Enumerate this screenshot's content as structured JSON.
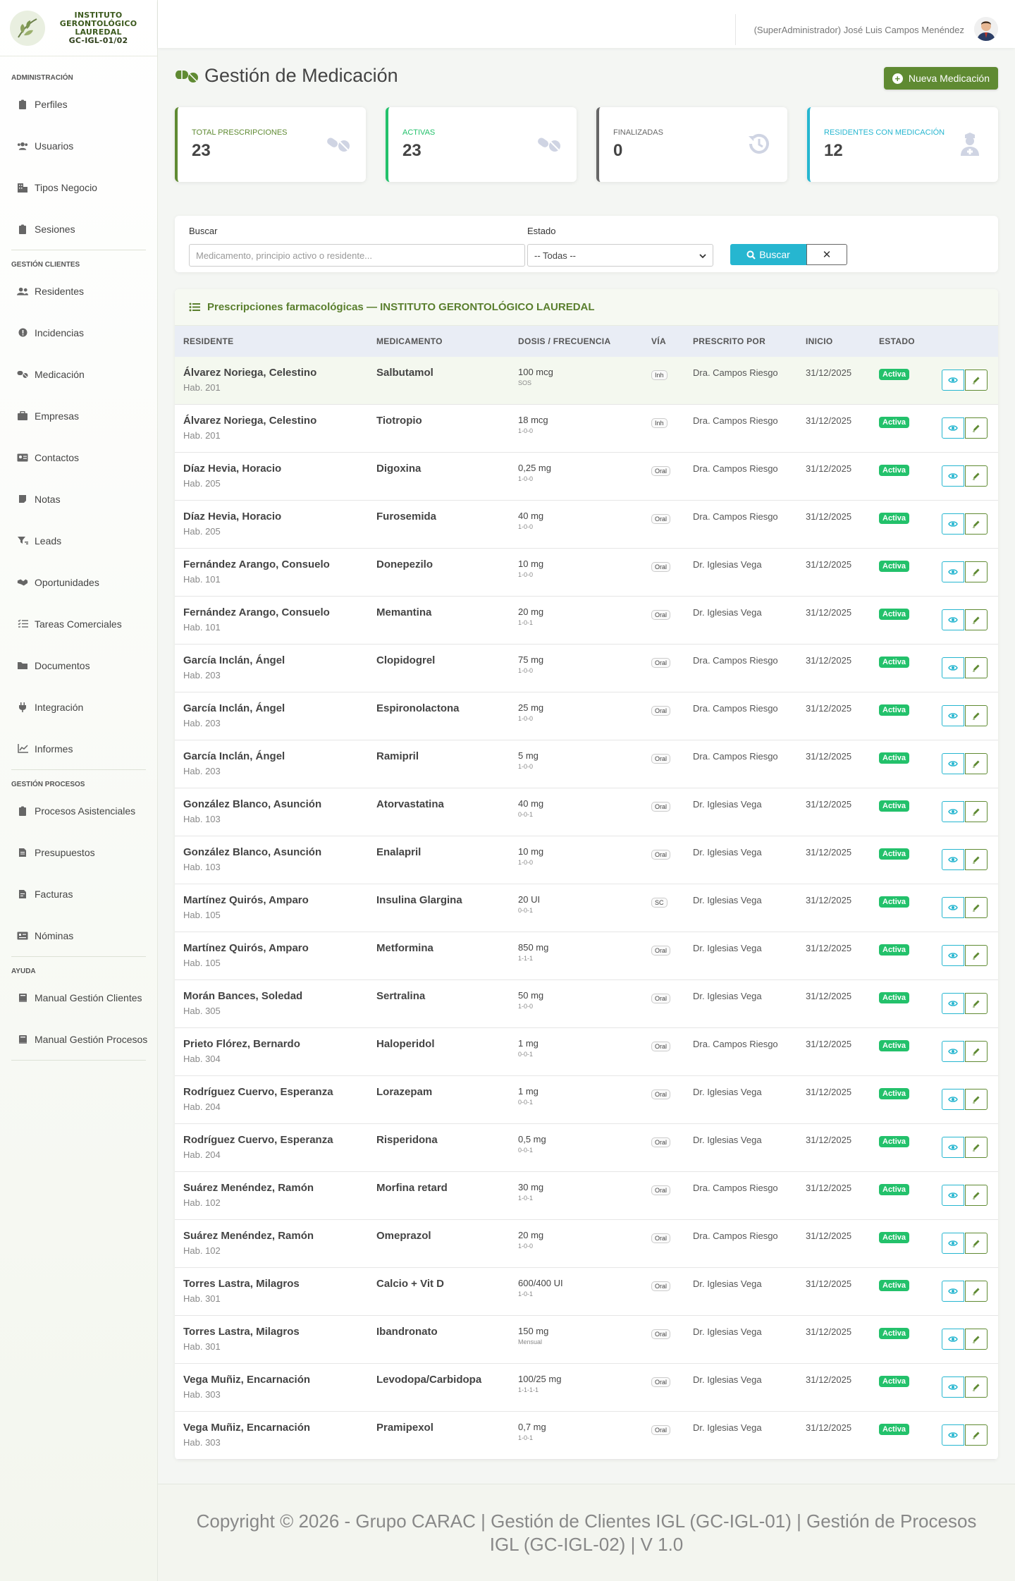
{
  "brand": {
    "line1": "INSTITUTO",
    "line2": "GERONTOLÓGICO",
    "line3": "LAUREDAL",
    "code": "GC-IGL-01/02"
  },
  "sidebar": {
    "sections": [
      {
        "title": "ADMINISTRACIÓN",
        "items": [
          {
            "label": "Perfiles",
            "icon": "clipboard-icon"
          },
          {
            "label": "Usuarios",
            "icon": "users-icon"
          },
          {
            "label": "Tipos Negocio",
            "icon": "building-icon"
          },
          {
            "label": "Sesiones",
            "icon": "clipboard-icon"
          }
        ]
      },
      {
        "title": "GESTIÓN CLIENTES",
        "items": [
          {
            "label": "Residentes",
            "icon": "user-group-icon"
          },
          {
            "label": "Incidencias",
            "icon": "alert-icon"
          },
          {
            "label": "Medicación",
            "icon": "pills-icon"
          },
          {
            "label": "Empresas",
            "icon": "briefcase-icon"
          },
          {
            "label": "Contactos",
            "icon": "contact-card-icon"
          },
          {
            "label": "Notas",
            "icon": "note-icon"
          },
          {
            "label": "Leads",
            "icon": "funnel-icon"
          },
          {
            "label": "Oportunidades",
            "icon": "handshake-icon"
          },
          {
            "label": "Tareas Comerciales",
            "icon": "tasks-icon"
          },
          {
            "label": "Documentos",
            "icon": "folder-icon"
          },
          {
            "label": "Integración",
            "icon": "plug-icon"
          },
          {
            "label": "Informes",
            "icon": "chart-line-icon"
          }
        ]
      },
      {
        "title": "GESTIÓN PROCESOS",
        "items": [
          {
            "label": "Procesos Asistenciales",
            "icon": "clipboard-icon"
          },
          {
            "label": "Presupuestos",
            "icon": "document-icon"
          },
          {
            "label": "Facturas",
            "icon": "invoice-icon"
          },
          {
            "label": "Nóminas",
            "icon": "payroll-icon"
          }
        ]
      },
      {
        "title": "AYUDA",
        "items": [
          {
            "label": "Manual Gestión Clientes",
            "icon": "book-icon"
          },
          {
            "label": "Manual Gestión Procesos",
            "icon": "book-icon"
          }
        ]
      }
    ]
  },
  "topbar": {
    "user": "(SuperAdministrador) José Luis Campos Menéndez"
  },
  "page": {
    "title": "Gestión de Medicación",
    "new_button": "Nueva Medicación"
  },
  "stats": [
    {
      "label": "TOTAL PRESCRIPCIONES",
      "value": "23",
      "color": "#5f8a32",
      "icon": "pills-icon"
    },
    {
      "label": "ACTIVAS",
      "value": "23",
      "color": "#23c16b",
      "icon": "pills-icon"
    },
    {
      "label": "FINALIZADAS",
      "value": "0",
      "color": "#666666",
      "icon": "history-icon"
    },
    {
      "label": "RESIDENTES CON MEDICACIÓN",
      "value": "12",
      "color": "#26b6d0",
      "icon": "user-nurse-icon"
    }
  ],
  "filters": {
    "search_label": "Buscar",
    "search_placeholder": "Medicamento, principio activo o residente...",
    "status_label": "Estado",
    "status_value": "-- Todas --",
    "search_button": "Buscar",
    "clear_button": "✕"
  },
  "table": {
    "title": "Prescripciones farmacológicas — INSTITUTO GERONTOLÓGICO LAUREDAL",
    "headers": [
      "RESIDENTE",
      "MEDICAMENTO",
      "DOSIS / FRECUENCIA",
      "VÍA",
      "PRESCRITO POR",
      "INICIO",
      "ESTADO"
    ],
    "rows": [
      {
        "name": "Álvarez Noriega, Celestino",
        "room": "Hab. 201",
        "med": "Salbutamol",
        "dose": "100 mcg",
        "freq": "SOS",
        "via": "Inh",
        "by": "Dra. Campos Riesgo",
        "start": "31/12/2025",
        "status": "Activa"
      },
      {
        "name": "Álvarez Noriega, Celestino",
        "room": "Hab. 201",
        "med": "Tiotropio",
        "dose": "18 mcg",
        "freq": "1-0-0",
        "via": "Inh",
        "by": "Dra. Campos Riesgo",
        "start": "31/12/2025",
        "status": "Activa"
      },
      {
        "name": "Díaz Hevia, Horacio",
        "room": "Hab. 205",
        "med": "Digoxina",
        "dose": "0,25 mg",
        "freq": "1-0-0",
        "via": "Oral",
        "by": "Dra. Campos Riesgo",
        "start": "31/12/2025",
        "status": "Activa"
      },
      {
        "name": "Díaz Hevia, Horacio",
        "room": "Hab. 205",
        "med": "Furosemida",
        "dose": "40 mg",
        "freq": "1-0-0",
        "via": "Oral",
        "by": "Dra. Campos Riesgo",
        "start": "31/12/2025",
        "status": "Activa"
      },
      {
        "name": "Fernández Arango, Consuelo",
        "room": "Hab. 101",
        "med": "Donepezilo",
        "dose": "10 mg",
        "freq": "1-0-0",
        "via": "Oral",
        "by": "Dr. Iglesias Vega",
        "start": "31/12/2025",
        "status": "Activa"
      },
      {
        "name": "Fernández Arango, Consuelo",
        "room": "Hab. 101",
        "med": "Memantina",
        "dose": "20 mg",
        "freq": "1-0-1",
        "via": "Oral",
        "by": "Dr. Iglesias Vega",
        "start": "31/12/2025",
        "status": "Activa"
      },
      {
        "name": "García Inclán, Ángel",
        "room": "Hab. 203",
        "med": "Clopidogrel",
        "dose": "75 mg",
        "freq": "1-0-0",
        "via": "Oral",
        "by": "Dra. Campos Riesgo",
        "start": "31/12/2025",
        "status": "Activa"
      },
      {
        "name": "García Inclán, Ángel",
        "room": "Hab. 203",
        "med": "Espironolactona",
        "dose": "25 mg",
        "freq": "1-0-0",
        "via": "Oral",
        "by": "Dra. Campos Riesgo",
        "start": "31/12/2025",
        "status": "Activa"
      },
      {
        "name": "García Inclán, Ángel",
        "room": "Hab. 203",
        "med": "Ramipril",
        "dose": "5 mg",
        "freq": "1-0-0",
        "via": "Oral",
        "by": "Dra. Campos Riesgo",
        "start": "31/12/2025",
        "status": "Activa"
      },
      {
        "name": "González Blanco, Asunción",
        "room": "Hab. 103",
        "med": "Atorvastatina",
        "dose": "40 mg",
        "freq": "0-0-1",
        "via": "Oral",
        "by": "Dr. Iglesias Vega",
        "start": "31/12/2025",
        "status": "Activa"
      },
      {
        "name": "González Blanco, Asunción",
        "room": "Hab. 103",
        "med": "Enalapril",
        "dose": "10 mg",
        "freq": "1-0-0",
        "via": "Oral",
        "by": "Dr. Iglesias Vega",
        "start": "31/12/2025",
        "status": "Activa"
      },
      {
        "name": "Martínez Quirós, Amparo",
        "room": "Hab. 105",
        "med": "Insulina Glargina",
        "dose": "20 UI",
        "freq": "0-0-1",
        "via": "SC",
        "by": "Dr. Iglesias Vega",
        "start": "31/12/2025",
        "status": "Activa"
      },
      {
        "name": "Martínez Quirós, Amparo",
        "room": "Hab. 105",
        "med": "Metformina",
        "dose": "850 mg",
        "freq": "1-1-1",
        "via": "Oral",
        "by": "Dr. Iglesias Vega",
        "start": "31/12/2025",
        "status": "Activa"
      },
      {
        "name": "Morán Bances, Soledad",
        "room": "Hab. 305",
        "med": "Sertralina",
        "dose": "50 mg",
        "freq": "1-0-0",
        "via": "Oral",
        "by": "Dr. Iglesias Vega",
        "start": "31/12/2025",
        "status": "Activa"
      },
      {
        "name": "Prieto Flórez, Bernardo",
        "room": "Hab. 304",
        "med": "Haloperidol",
        "dose": "1 mg",
        "freq": "0-0-1",
        "via": "Oral",
        "by": "Dra. Campos Riesgo",
        "start": "31/12/2025",
        "status": "Activa"
      },
      {
        "name": "Rodríguez Cuervo, Esperanza",
        "room": "Hab. 204",
        "med": "Lorazepam",
        "dose": "1 mg",
        "freq": "0-0-1",
        "via": "Oral",
        "by": "Dr. Iglesias Vega",
        "start": "31/12/2025",
        "status": "Activa"
      },
      {
        "name": "Rodríguez Cuervo, Esperanza",
        "room": "Hab. 204",
        "med": "Risperidona",
        "dose": "0,5 mg",
        "freq": "0-0-1",
        "via": "Oral",
        "by": "Dr. Iglesias Vega",
        "start": "31/12/2025",
        "status": "Activa"
      },
      {
        "name": "Suárez Menéndez, Ramón",
        "room": "Hab. 102",
        "med": "Morfina retard",
        "dose": "30 mg",
        "freq": "1-0-1",
        "via": "Oral",
        "by": "Dra. Campos Riesgo",
        "start": "31/12/2025",
        "status": "Activa"
      },
      {
        "name": "Suárez Menéndez, Ramón",
        "room": "Hab. 102",
        "med": "Omeprazol",
        "dose": "20 mg",
        "freq": "1-0-0",
        "via": "Oral",
        "by": "Dra. Campos Riesgo",
        "start": "31/12/2025",
        "status": "Activa"
      },
      {
        "name": "Torres Lastra, Milagros",
        "room": "Hab. 301",
        "med": "Calcio + Vit D",
        "dose": "600/400 UI",
        "freq": "1-0-1",
        "via": "Oral",
        "by": "Dr. Iglesias Vega",
        "start": "31/12/2025",
        "status": "Activa"
      },
      {
        "name": "Torres Lastra, Milagros",
        "room": "Hab. 301",
        "med": "Ibandronato",
        "dose": "150 mg",
        "freq": "Mensual",
        "via": "Oral",
        "by": "Dr. Iglesias Vega",
        "start": "31/12/2025",
        "status": "Activa"
      },
      {
        "name": "Vega Muñiz, Encarnación",
        "room": "Hab. 303",
        "med": "Levodopa/Carbidopa",
        "dose": "100/25 mg",
        "freq": "1-1-1-1",
        "via": "Oral",
        "by": "Dr. Iglesias Vega",
        "start": "31/12/2025",
        "status": "Activa"
      },
      {
        "name": "Vega Muñiz, Encarnación",
        "room": "Hab. 303",
        "med": "Pramipexol",
        "dose": "0,7 mg",
        "freq": "1-0-1",
        "via": "Oral",
        "by": "Dr. Iglesias Vega",
        "start": "31/12/2025",
        "status": "Activa"
      }
    ]
  },
  "footer": {
    "text": "Copyright © 2026 - Grupo CARAC | Gestión de Clientes IGL (GC-IGL-01) | Gestión de Procesos IGL (GC-IGL-02) | V 1.0"
  },
  "colors": {
    "brand_green": "#5f8a32",
    "info_cyan": "#26b6d0",
    "active_badge": "#23c16b"
  }
}
